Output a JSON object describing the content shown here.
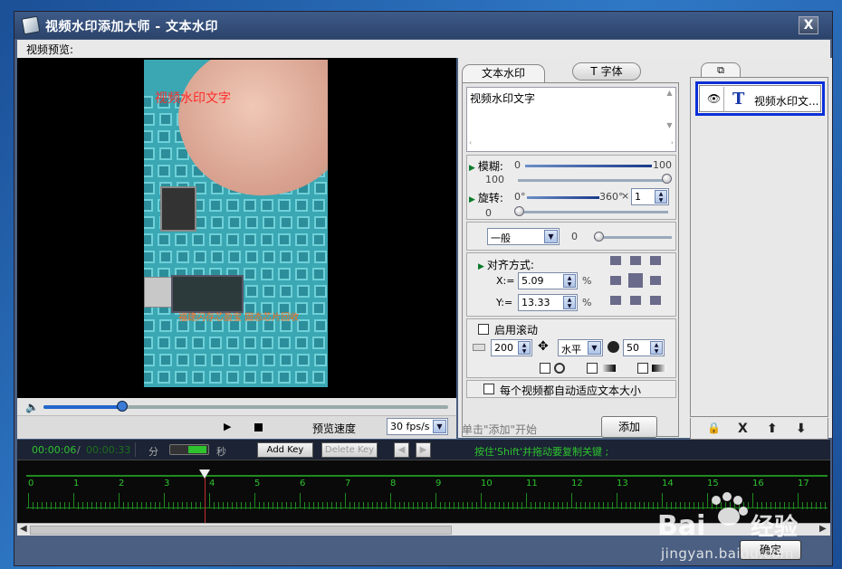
{
  "window": {
    "title": "视频水印添加大师 - 文本水印",
    "close_label": "X",
    "preview_label": "视频预览:"
  },
  "video": {
    "watermark_main": "视频水印文字",
    "watermark_sub": "福建闪存芯盈宝 固态芯片回收"
  },
  "player": {
    "play_icon": "play-icon",
    "stop_icon": "stop-icon",
    "speed_label": "预览速度",
    "speed_value": "30 fps/s"
  },
  "panel": {
    "tabs": [
      {
        "label": "文本水印"
      },
      {
        "label": "T 字体"
      }
    ],
    "text_value": "视频水印文字",
    "blur": {
      "label": "模糊:",
      "min": "0",
      "max": "100",
      "value": "100",
      "level": 1.0
    },
    "rotate": {
      "label": "旋转:",
      "min": "0°",
      "max": "360°",
      "multiply": "×",
      "count": "1",
      "value": "0",
      "level": 0.0
    },
    "mode": {
      "value": "一般",
      "number": "0"
    },
    "align": {
      "label": "对齐方式:",
      "x_label": "X:=",
      "x_value": "5.09",
      "y_label": "Y:=",
      "y_value": "13.33",
      "unit": "%"
    },
    "scroll": {
      "label": "启用滚动",
      "speed": "200",
      "direction": "水平",
      "time": "50"
    },
    "autofit_label": "每个视频都自动适应文本大小",
    "hint": "单击\"添加\"开始",
    "add_label": "添加"
  },
  "layers": {
    "item_label": "视频水印文...",
    "item_icon": "T",
    "tools": [
      "🔒",
      "X",
      "⬆",
      "⬇"
    ]
  },
  "timeline": {
    "current_time": "00:00:06",
    "separator": "/",
    "total_time": "00:00:33",
    "unit_min": "分",
    "unit_sec": "秒",
    "add_key": "Add Key",
    "delete_key": "Delete Key",
    "hint": "按住'Shift'并拖动要复制关键 ;",
    "marks": [
      "0",
      "1",
      "2",
      "3",
      "4",
      "5",
      "6",
      "7",
      "8",
      "9",
      "10",
      "11",
      "12",
      "13",
      "14",
      "15",
      "16",
      "17"
    ]
  },
  "footer": {
    "ok_label": "确定",
    "watermark_site": "jingyan.baidu.com",
    "baidu_logo": "Bai",
    "baidu_logo_tail": "经验"
  }
}
